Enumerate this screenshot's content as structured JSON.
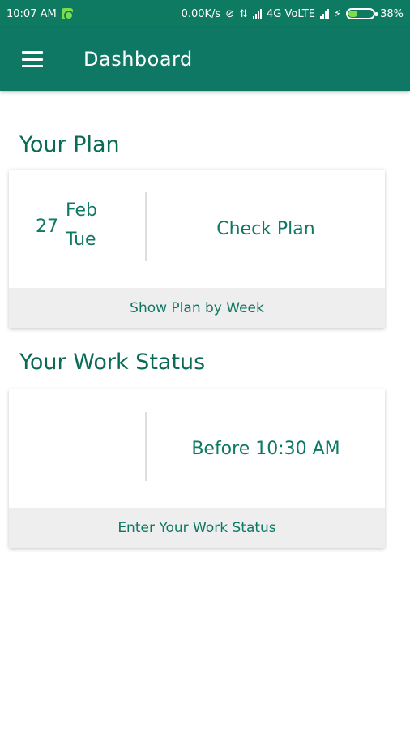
{
  "status_bar": {
    "time": "10:07 AM",
    "speed": "0.00K/s",
    "network": "4G VoLTE",
    "battery": "38%",
    "battery_level": 0.38
  },
  "app_bar": {
    "title": "Dashboard"
  },
  "plan": {
    "section_title": "Your Plan",
    "day": "27",
    "month": "Feb",
    "weekday": "Tue",
    "action_label": "Check Plan",
    "footer_label": "Show Plan by Week"
  },
  "work_status": {
    "section_title": "Your Work Status",
    "action_label": "Before 10:30 AM",
    "footer_label": "Enter Your Work Status"
  },
  "colors": {
    "primary": "#0f7864",
    "status_bar": "#0e7a62",
    "footer_bg": "#eeeeee"
  }
}
